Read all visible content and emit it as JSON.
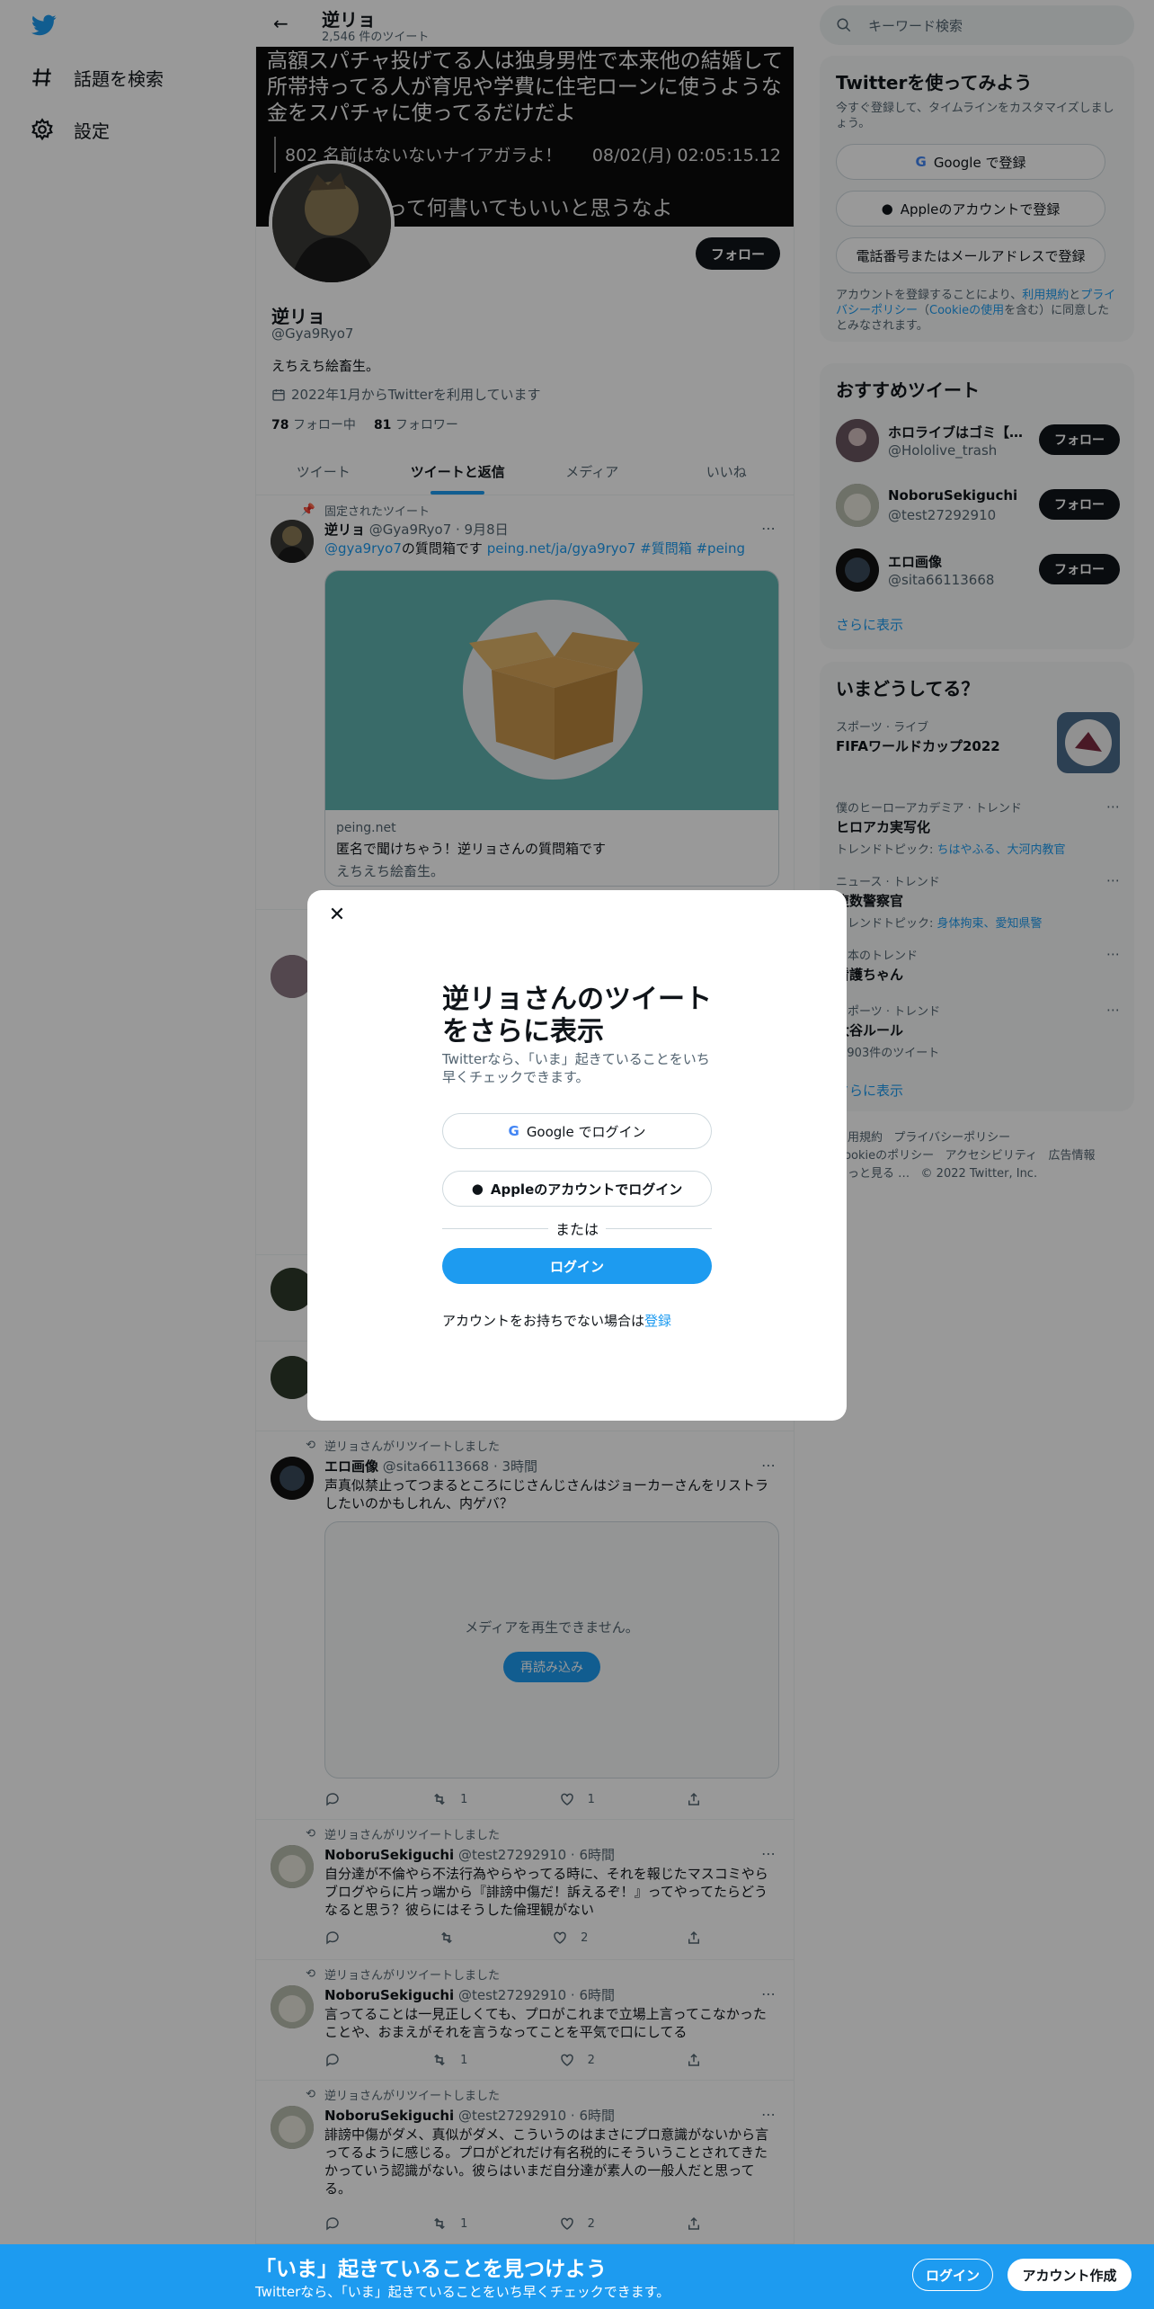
{
  "nav": {
    "explore_label": "話題を検索",
    "settings_label": "設定"
  },
  "header": {
    "name": "逆リョ",
    "tweet_count": "2,546 件のツイート"
  },
  "banner": {
    "line1": "高額スパチャ投げてる人は独身男性で本来他の結婚して所帯持ってる人が育児や学費に住宅ローンに使うような金をスパチャに使ってるだけだよ",
    "quote_no": "802 名前はないないナイアガラよ！",
    "quote_date": "08/02(月) 02:05:15.12",
    "line3": "って何書いてもいいと思うなよ"
  },
  "profile": {
    "follow_label": "フォロー",
    "name": "逆リョ",
    "handle": "@Gya9Ryo7",
    "bio": "えちえち絵畜生。",
    "joined": "2022年1月からTwitterを利用しています",
    "following_count": "78",
    "following_label": "フォロー中",
    "followers_count": "81",
    "followers_label": "フォロワー"
  },
  "tabs": [
    "ツイート",
    "ツイートと返信",
    "メディア",
    "いいね"
  ],
  "tweets": {
    "pinned": {
      "context": "固定されたツイート",
      "name": "逆リョ",
      "meta": "@Gya9Ryo7 · 9月8日",
      "mention": "@gya9ryo7",
      "text_mid": "の質問箱です ",
      "link": "peing.net/ja/gya9ryo7 #質問箱 #peing",
      "card_domain": "peing.net",
      "card_title": "匿名で聞けちゃう！逆リョさんの質問箱です",
      "card_desc": "えちえち絵畜生。"
    },
    "t2": {
      "context": "逆リョさんがリツイートしました",
      "name": "エロ画像",
      "meta": "@sita66113668 · 3時間",
      "text": "声真似禁止ってつまるところにじさんじさんはジョーカーさんをリストラしたいのかもしれん、内ゲバ？",
      "media_error": "メディアを再生できません。",
      "reload_label": "再読み込み",
      "retweets": "1",
      "likes": "1"
    },
    "t3": {
      "context": "逆リョさんがリツイートしました",
      "name": "NoboruSekiguchi",
      "meta": "@test27292910 · 6時間",
      "text": "自分達が不倫やら不法行為やらやってる時に、それを報じたマスコミやらブログやらに片っ端から『誹謗中傷だ！訴えるぞ！』ってやってたらどうなると思う？彼らにはそうした倫理観がない",
      "likes": "2"
    },
    "t4": {
      "context": "逆リョさんがリツイートしました",
      "name": "NoboruSekiguchi",
      "meta": "@test27292910 · 6時間",
      "text": "言ってることは一見正しくても、プロがこれまで立場上言ってこなかったことや、おまえがそれを言うなってことを平気で口にしてる",
      "retweets": "1",
      "likes": "2"
    },
    "t5": {
      "context": "逆リョさんがリツイートしました",
      "name": "NoboruSekiguchi",
      "meta": "@test27292910 · 6時間",
      "text": "誹謗中傷がダメ、真似がダメ、こういうのはまさにプロ意識がないから言ってるように感じる。プロがどれだけ有名税的にそういうことされてきたかっていう認識がない。彼らはいまだ自分達が素人の一般人だと思ってる。",
      "retweets": "1",
      "likes": "2"
    }
  },
  "sidebar": {
    "search_placeholder": "キーワード検索",
    "signup": {
      "title": "Twitterを使ってみよう",
      "subtitle": "今すぐ登録して、タイムラインをカスタマイズしましょう。",
      "google_label": "Google で登録",
      "apple_label": "Appleのアカウントで登録",
      "phone_label": "電話番号またはメールアドレスで登録",
      "terms_pre": "アカウントを登録することにより、",
      "terms_link": "利用規約",
      "terms_mid": "と",
      "privacy_link": "プライバシーポリシー",
      "cookie_pre": "（",
      "cookie_link": "Cookieの使用",
      "terms_post": "を含む）に同意したとみなされます。"
    },
    "recommend": {
      "title": "おすすめツイート",
      "items": [
        {
          "name": "ホロライブはゴミ【…",
          "handle": "@Hololive_trash",
          "follow": "フォロー"
        },
        {
          "name": "NoboruSekiguchi",
          "handle": "@test27292910",
          "follow": "フォロー"
        },
        {
          "name": "エロ画像",
          "handle": "@sita66113668",
          "follow": "フォロー"
        }
      ],
      "more": "さらに表示"
    },
    "trends": {
      "title": "いまどうしてる？",
      "items": [
        {
          "category": "スポーツ · ライブ",
          "title": "FIFAワールドカップ2022",
          "sub": ""
        },
        {
          "category": "僕のヒーローアカデミア · トレンド",
          "title": "ヒロアカ実写化",
          "sub_pre": "トレンドトピック: ",
          "sub_links": "ちはやふる、大河内教官"
        },
        {
          "category": "ニュース · トレンド",
          "title": "複数警察官",
          "sub_pre": "トレンドトピック: ",
          "sub_links": "身体拘束、愛知県警"
        },
        {
          "category": "日本のトレンド",
          "title": "看護ちゃん",
          "sub": ""
        },
        {
          "category": "スポーツ · トレンド",
          "title": "大谷ルール",
          "sub": "1,903件のツイート"
        }
      ],
      "more": "さらに表示"
    },
    "footer": {
      "terms": "利用規約",
      "privacy": "プライバシーポリシー",
      "cookie": "Cookieのポリシー",
      "accessibility": "アクセシビリティ",
      "ads": "広告情報",
      "more": "もっと見る …",
      "copyright": "© 2022 Twitter, Inc."
    }
  },
  "modal": {
    "title": "逆リョさんのツイートをさらに表示",
    "subtitle": "Twitterなら、「いま」起きていることをいち早くチェックできます。",
    "google_label": "Google でログイン",
    "apple_label": "Appleのアカウントでログイン",
    "or_label": "または",
    "login_label": "ログイン",
    "register_pre": "アカウントをお持ちでない場合は",
    "register_link": "登録"
  },
  "bottom_bar": {
    "title": "「いま」起きていることを見つけよう",
    "subtitle": "Twitterなら、「いま」起きていることをいち早くチェックできます。",
    "login_label": "ログイン",
    "signup_label": "アカウント作成"
  },
  "colors": {
    "accent": "#1d9bf0",
    "dark": "#0f1419",
    "muted": "#536471"
  }
}
